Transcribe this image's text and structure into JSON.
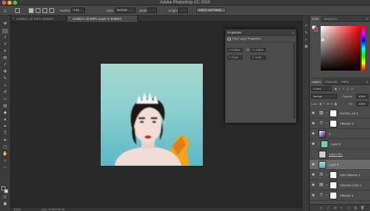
{
  "app": {
    "title": "Adobe Photoshop CC 2019"
  },
  "options_bar": {
    "feather_label": "Feather:",
    "feather_value": "0 px",
    "style_label": "Style:",
    "style_value": "Normal",
    "width_label": "Width:",
    "height_label": "Height:",
    "select_mask_label": "Select and Mask..."
  },
  "tabs": [
    {
      "label": "Untitled-1 @ 100% (RGB/8*)"
    },
    {
      "label": "Untitled-2 @ 800% (Layer 9, RGB/8*)"
    }
  ],
  "status_bar": {
    "zoom": "200%",
    "doc_size": "Doc: 29.3K/740.4K"
  },
  "properties": {
    "title": "Properties",
    "subtitle": "Pixel Layer Properties",
    "w_label": "W:",
    "w_value": "1.25 in",
    "h_label": "H:",
    "h_value": "1.25 in",
    "x_label": "X:",
    "x_value": "0 cm",
    "y_label": "Y:",
    "y_value": "0 cm",
    "link_icon": "link-icon"
  },
  "color_panel": {
    "tabs": [
      {
        "label": "Color"
      },
      {
        "label": "Swatches"
      }
    ],
    "fg_color": "#c1272d",
    "bg_color": "#f0f0f0"
  },
  "layers_panel": {
    "tabs": [
      {
        "label": "Layers"
      },
      {
        "label": "Channels"
      },
      {
        "label": "Paths"
      }
    ],
    "kind_label": "Kind",
    "blend_mode": "Normal",
    "opacity_label": "Opacity:",
    "opacity_value": "100%",
    "lock_label": "Lock:",
    "fill_label": "Fill:",
    "fill_value": "100%",
    "layers": [
      {
        "name": "Hue/Sa...ion 1",
        "kind": "adjustment",
        "icon": "hue-saturation-icon"
      },
      {
        "name": "Vibrance 2",
        "kind": "adjustment",
        "icon": "vibrance-icon"
      },
      {
        "name": "3",
        "kind": "pixel",
        "thumb": "#8a5bb0"
      },
      {
        "name": "Layer 8",
        "kind": "pixel",
        "thumb": "#6fd1b8"
      },
      {
        "name": "Color Fill 1",
        "kind": "fill",
        "thumb": "#cfcfcf"
      },
      {
        "name": "Layer 9",
        "kind": "pixel",
        "thumb": "#9fd4c6",
        "selected": true
      },
      {
        "name": "Color Balance 2",
        "kind": "adjustment",
        "icon": "color-balance-icon"
      },
      {
        "name": "Selective Color 1",
        "kind": "adjustment",
        "icon": "selective-color-icon"
      },
      {
        "name": "Vibrance 1",
        "kind": "adjustment",
        "icon": "vibrance-icon"
      }
    ]
  }
}
